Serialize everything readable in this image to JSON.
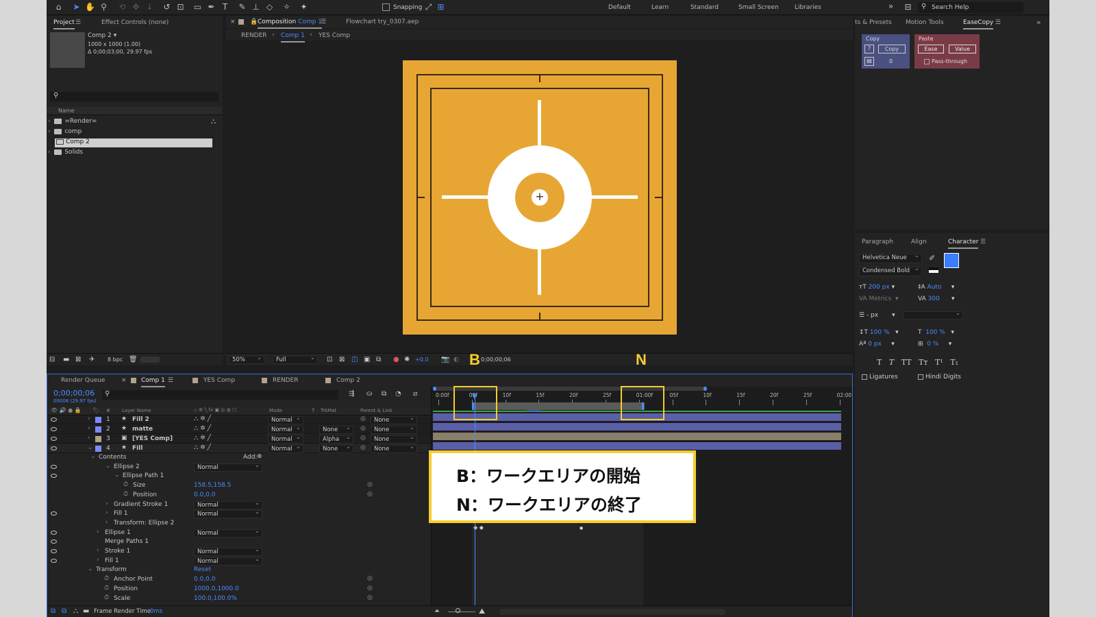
{
  "toolbar": {
    "snapping": "Snapping",
    "workspaces": [
      "Default",
      "Learn",
      "Standard",
      "Small Screen",
      "Libraries"
    ],
    "search": "Search Help"
  },
  "project": {
    "tab": "Project",
    "effect_controls": "Effect Controls (none)",
    "item_name": "Comp 2 ▾",
    "item_size": "1000 x 1000 (1.00)",
    "item_duration": "Δ 0;00;03;00, 29.97 fps",
    "col_name": "Name",
    "items": [
      {
        "label": "=Render="
      },
      {
        "label": "comp"
      },
      {
        "label": "Comp 2"
      },
      {
        "label": "Solids"
      }
    ],
    "bpc": "8 bpc"
  },
  "comp_viewer": {
    "tab_prefix": "Composition",
    "tab_comp": "Comp 1",
    "file": "Flowchart try_0307.aep",
    "breadcrumbs": [
      "RENDER",
      "Comp 1",
      "YES Comp"
    ],
    "zoom": "50%",
    "resolution": "Full",
    "exposure": "+0.0",
    "timecode": "0;00;00;06"
  },
  "right_panel": {
    "tabs": [
      "ts & Presets",
      "Motion Tools",
      "EaseCopy"
    ],
    "copy_label": "Copy",
    "copy_q": "?",
    "copy_btn": "Copy",
    "copy_num": "0",
    "paste_label": "Paste",
    "ease_btn": "Ease",
    "value_btn": "Value",
    "pass_through": "Pass-through"
  },
  "character": {
    "tabs": [
      "Paragraph",
      "Align",
      "Character"
    ],
    "font": "Helvetica Neue",
    "style": "Condensed Bold",
    "size": "200 px",
    "leading": "Auto",
    "kerning": "Metrics",
    "tracking": "300",
    "stroke": "- px",
    "vscale": "100 %",
    "hscale": "100 %",
    "baseline": "0 px",
    "tsume": "0 %",
    "style_buttons": [
      "T",
      "T",
      "TT",
      "Tт",
      "T¹",
      "T₁"
    ],
    "ligatures": "Ligatures",
    "hindi": "Hindi Digits",
    "fill_color": "#3a7dff"
  },
  "timeline": {
    "tabs": [
      "Render Queue",
      "Comp 1",
      "YES Comp",
      "RENDER",
      "Comp 2"
    ],
    "time": "0;00;00;06",
    "frame_info": "00006 (29.97 fps)",
    "cols": {
      "layer_name": "Layer Name",
      "mode": "Mode",
      "t": "T",
      "trkmat": "TrkMat",
      "parent": "Parent & Link"
    },
    "layers": [
      {
        "num": "1",
        "name": "Fill 2",
        "mode": "Normal",
        "trk": "",
        "parent": "None",
        "color": "#7a8bff"
      },
      {
        "num": "2",
        "name": "matte",
        "mode": "Normal",
        "trk": "None",
        "parent": "None",
        "color": "#7a8bff"
      },
      {
        "num": "3",
        "name": "[YES Comp]",
        "mode": "Normal",
        "trk": "Alpha",
        "parent": "None",
        "color": "#b0a48a"
      },
      {
        "num": "4",
        "name": "Fill",
        "mode": "Normal",
        "trk": "None",
        "parent": "None",
        "color": "#7a8bff"
      }
    ],
    "props": [
      {
        "label": "Contents",
        "value": "",
        "mode": "",
        "add": "Add:"
      },
      {
        "label": "Ellipse 2",
        "mode": "Normal"
      },
      {
        "label": "Ellipse Path 1",
        "mode": ""
      },
      {
        "label": "Size",
        "value": "158.5,158.5"
      },
      {
        "label": "Position",
        "value": "0.0,0.0"
      },
      {
        "label": "Gradient Stroke 1",
        "mode": "Normal"
      },
      {
        "label": "Fill 1",
        "mode": "Normal"
      },
      {
        "label": "Transform: Ellipse 2",
        "mode": ""
      },
      {
        "label": "Ellipse 1",
        "mode": "Normal"
      },
      {
        "label": "Merge Paths 1",
        "mode": ""
      },
      {
        "label": "Stroke 1",
        "mode": "Normal"
      },
      {
        "label": "Fill 1",
        "mode": "Normal"
      },
      {
        "label": "Transform",
        "value": "Reset"
      },
      {
        "label": "Anchor Point",
        "value": "0.0,0.0"
      },
      {
        "label": "Position",
        "value": "1000.0,1000.0"
      },
      {
        "label": "Scale",
        "value": "100.0,100.0%"
      }
    ],
    "ruler": [
      "0:00f",
      "05f",
      "10f",
      "15f",
      "20f",
      "25f",
      "01:00f",
      "05f",
      "10f",
      "15f",
      "20f",
      "25f",
      "02:00"
    ],
    "render_time_label": "Frame Render Time",
    "render_time": "0ms"
  },
  "annotation": {
    "b_tag": "B",
    "n_tag": "N",
    "line1": "B：ワークエリアの開始",
    "line2": "N：ワークエリアの終了"
  },
  "colors": {
    "accent": "#4a8cff",
    "comp_bg": "#e7a634",
    "highlight": "#f6cd2f",
    "layer_bar": "#5b5fa8"
  }
}
